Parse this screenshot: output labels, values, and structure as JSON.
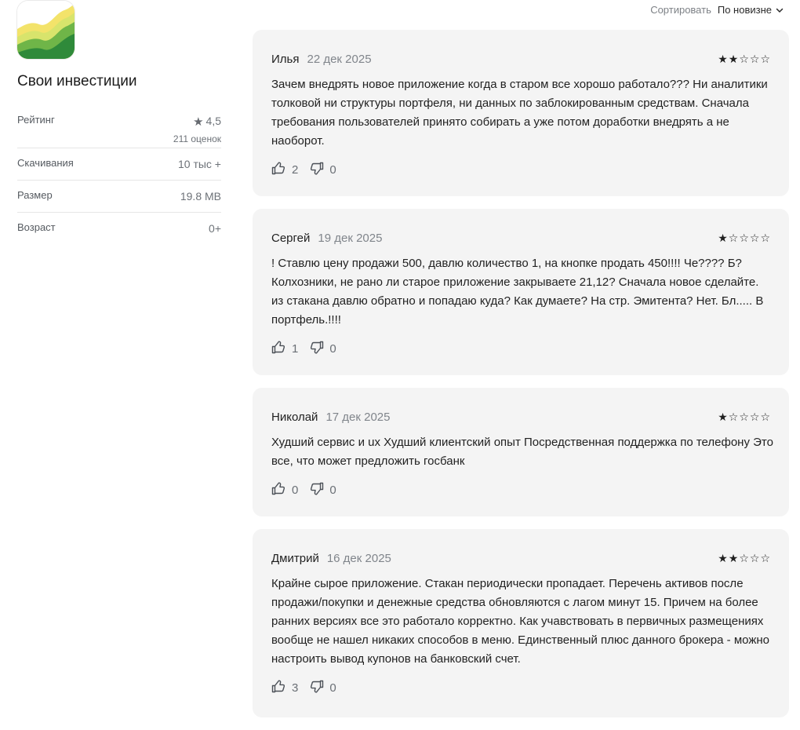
{
  "app": {
    "title": "Свои инвестиции",
    "icon": "app-logo-icon",
    "rating_label": "Рейтинг",
    "rating_value": "4,5",
    "rating_count": "211 оценок",
    "downloads_label": "Скачивания",
    "downloads_value": "10 тыс +",
    "size_label": "Размер",
    "size_value": "19.8 MB",
    "age_label": "Возраст",
    "age_value": "0+"
  },
  "sort": {
    "label": "Сортировать",
    "value": "По новизне"
  },
  "reviews": [
    {
      "author": "Илья",
      "date": "22 дек 2025",
      "stars": 2,
      "text": "Зачем внедрять новое приложение когда в старом все хорошо работало??? Ни аналитики толковой ни структуры портфеля, ни данных по заблокированным сред­ствам. Сначала требования пользователей принято собирать а уже потом дора­ботки внедрять а не наоборот.",
      "likes": "2",
      "dislikes": "0"
    },
    {
      "author": "Сергей",
      "date": "19 дек 2025",
      "stars": 1,
      "text": "! Ставлю цену продажи 500, давлю количество 1, на кнопке продать 450!!!! Че???? Б? Колхозники, не рано ли старое приложение закрываете 21,12? Сначала новое сделайте. из стакана давлю обратно и попадаю куда? Как думаете? На стр. Эми­тента? Нет. Бл..... В портфель.!!!!",
      "likes": "1",
      "dislikes": "0"
    },
    {
      "author": "Николай",
      "date": "17 дек 2025",
      "stars": 1,
      "text": "Худший сервис и ux Худший клиентский опыт Посредственная поддержка по теле­фону Это все, что может предложить госбанк",
      "likes": "0",
      "dislikes": "0"
    },
    {
      "author": "Дмитрий",
      "date": "16 дек 2025",
      "stars": 2,
      "text": "Крайне сырое приложение. Стакан периодически пропадает. Перечень активов после продажи/покупки и денежные средства обновляются с лагом минут 15. При­чем на более ранних версиях все это работало корректно. Как учавствовать в пер­вичных размещениях вообще не нашел никаких способов в меню. Единственный плюс данного брокера - можно настроить вывод купонов на банковский счет.",
      "likes": "3",
      "dislikes": "0"
    }
  ]
}
